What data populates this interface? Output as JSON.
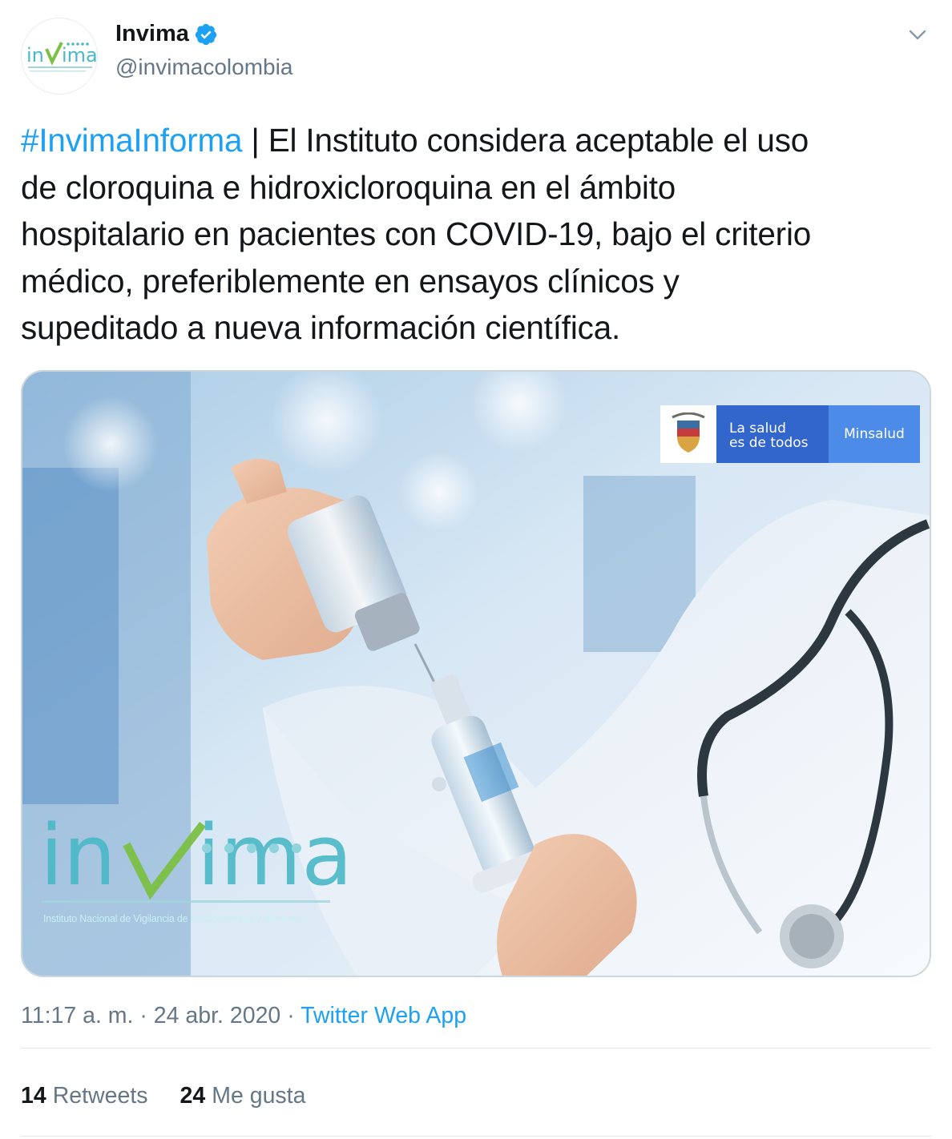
{
  "author": {
    "display_name": "Invima",
    "handle": "@invimacolombia",
    "avatar_logo_text": "Invima"
  },
  "tweet": {
    "hashtag": "#InvimaInforma",
    "text_lines": [
      " | El Instituto considera aceptable el uso",
      "de cloroquina e hidroxicloroquina en el ámbito",
      "hospitalario en pacientes con COVID-19, bajo el criterio",
      "médico, preferiblemente en ensayos clínicos y",
      "supeditado a nueva información científica."
    ]
  },
  "media": {
    "badge_slogan_line1": "La salud",
    "badge_slogan_line2": "es de todos",
    "badge_ministry": "Minsalud",
    "logo_subtitle": "Instituto Nacional de Vigilancia de Medicamentos y Alimentos"
  },
  "meta": {
    "time": "11:17 a. m.",
    "separator": " · ",
    "date": "24 abr. 2020",
    "source": "Twitter Web App"
  },
  "stats": {
    "retweets_count": "14",
    "retweets_label": "Retweets",
    "likes_count": "24",
    "likes_label": "Me gusta"
  },
  "colors": {
    "link_blue": "#1da1f2",
    "muted": "#657786",
    "text": "#14171a",
    "verified": "#1da1f2"
  },
  "icons": {
    "verified": "verified-badge-icon",
    "caret": "chevron-down-icon"
  }
}
